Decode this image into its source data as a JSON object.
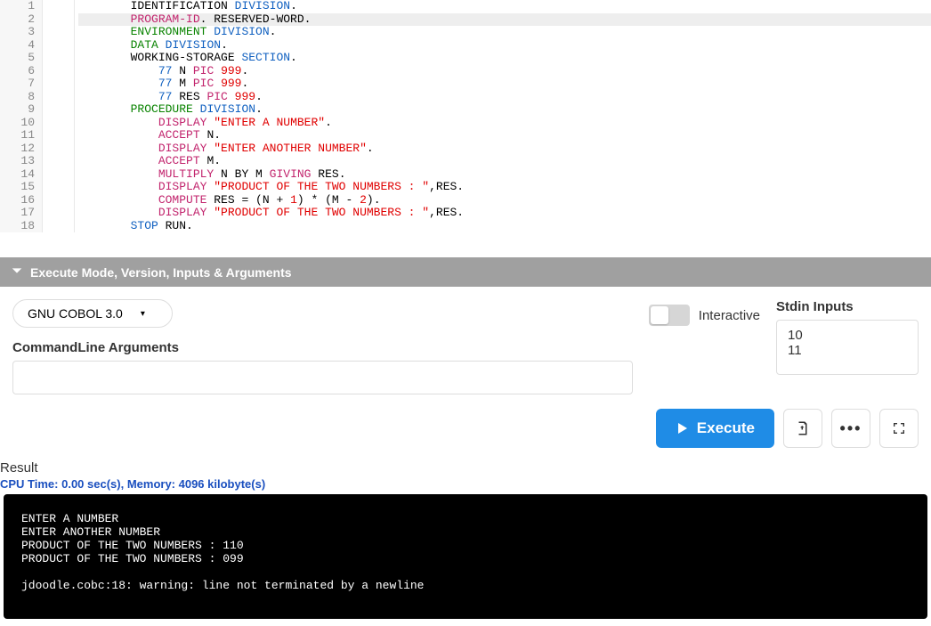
{
  "editor": {
    "lines": [
      {
        "n": 1,
        "hl": false,
        "tokens": [
          {
            "t": "       IDENTIFICATION ",
            "c": "kw-black"
          },
          {
            "t": "DIVISION",
            "c": "kw-blue"
          },
          {
            "t": ".",
            "c": "kw-black"
          }
        ]
      },
      {
        "n": 2,
        "hl": true,
        "tokens": [
          {
            "t": "       ",
            "c": "kw-black"
          },
          {
            "t": "PROGRAM-ID",
            "c": "kw-pink"
          },
          {
            "t": ". RESERVED-WORD.",
            "c": "kw-black"
          }
        ]
      },
      {
        "n": 3,
        "hl": false,
        "tokens": [
          {
            "t": "       ",
            "c": "kw-black"
          },
          {
            "t": "ENVIRONMENT",
            "c": "kw-green"
          },
          {
            "t": " ",
            "c": "kw-black"
          },
          {
            "t": "DIVISION",
            "c": "kw-blue"
          },
          {
            "t": ".",
            "c": "kw-black"
          }
        ]
      },
      {
        "n": 4,
        "hl": false,
        "tokens": [
          {
            "t": "       ",
            "c": "kw-black"
          },
          {
            "t": "DATA",
            "c": "kw-green"
          },
          {
            "t": " ",
            "c": "kw-black"
          },
          {
            "t": "DIVISION",
            "c": "kw-blue"
          },
          {
            "t": ".",
            "c": "kw-black"
          }
        ]
      },
      {
        "n": 5,
        "hl": false,
        "tokens": [
          {
            "t": "       WORKING-STORAGE ",
            "c": "kw-black"
          },
          {
            "t": "SECTION",
            "c": "kw-blue"
          },
          {
            "t": ".",
            "c": "kw-black"
          }
        ]
      },
      {
        "n": 6,
        "hl": false,
        "tokens": [
          {
            "t": "           ",
            "c": "kw-black"
          },
          {
            "t": "77",
            "c": "kw-blue"
          },
          {
            "t": " N ",
            "c": "kw-black"
          },
          {
            "t": "PIC",
            "c": "kw-pink"
          },
          {
            "t": " ",
            "c": "kw-black"
          },
          {
            "t": "999",
            "c": "kw-red"
          },
          {
            "t": ".",
            "c": "kw-black"
          }
        ]
      },
      {
        "n": 7,
        "hl": false,
        "tokens": [
          {
            "t": "           ",
            "c": "kw-black"
          },
          {
            "t": "77",
            "c": "kw-blue"
          },
          {
            "t": " M ",
            "c": "kw-black"
          },
          {
            "t": "PIC",
            "c": "kw-pink"
          },
          {
            "t": " ",
            "c": "kw-black"
          },
          {
            "t": "999",
            "c": "kw-red"
          },
          {
            "t": ".",
            "c": "kw-black"
          }
        ]
      },
      {
        "n": 8,
        "hl": false,
        "tokens": [
          {
            "t": "           ",
            "c": "kw-black"
          },
          {
            "t": "77",
            "c": "kw-blue"
          },
          {
            "t": " RES ",
            "c": "kw-black"
          },
          {
            "t": "PIC",
            "c": "kw-pink"
          },
          {
            "t": " ",
            "c": "kw-black"
          },
          {
            "t": "999",
            "c": "kw-red"
          },
          {
            "t": ".",
            "c": "kw-black"
          }
        ]
      },
      {
        "n": 9,
        "hl": false,
        "tokens": [
          {
            "t": "       ",
            "c": "kw-black"
          },
          {
            "t": "PROCEDURE",
            "c": "kw-green"
          },
          {
            "t": " ",
            "c": "kw-black"
          },
          {
            "t": "DIVISION",
            "c": "kw-blue"
          },
          {
            "t": ".",
            "c": "kw-black"
          }
        ]
      },
      {
        "n": 10,
        "hl": false,
        "tokens": [
          {
            "t": "           ",
            "c": "kw-black"
          },
          {
            "t": "DISPLAY",
            "c": "kw-pink"
          },
          {
            "t": " ",
            "c": "kw-black"
          },
          {
            "t": "\"ENTER A NUMBER\"",
            "c": "kw-red"
          },
          {
            "t": ".",
            "c": "kw-black"
          }
        ]
      },
      {
        "n": 11,
        "hl": false,
        "tokens": [
          {
            "t": "           ",
            "c": "kw-black"
          },
          {
            "t": "ACCEPT",
            "c": "kw-pink"
          },
          {
            "t": " N.",
            "c": "kw-black"
          }
        ]
      },
      {
        "n": 12,
        "hl": false,
        "tokens": [
          {
            "t": "           ",
            "c": "kw-black"
          },
          {
            "t": "DISPLAY",
            "c": "kw-pink"
          },
          {
            "t": " ",
            "c": "kw-black"
          },
          {
            "t": "\"ENTER ANOTHER NUMBER\"",
            "c": "kw-red"
          },
          {
            "t": ".",
            "c": "kw-black"
          }
        ]
      },
      {
        "n": 13,
        "hl": false,
        "tokens": [
          {
            "t": "           ",
            "c": "kw-black"
          },
          {
            "t": "ACCEPT",
            "c": "kw-pink"
          },
          {
            "t": " M.",
            "c": "kw-black"
          }
        ]
      },
      {
        "n": 14,
        "hl": false,
        "tokens": [
          {
            "t": "           ",
            "c": "kw-black"
          },
          {
            "t": "MULTIPLY",
            "c": "kw-pink"
          },
          {
            "t": " N BY M ",
            "c": "kw-black"
          },
          {
            "t": "GIVING",
            "c": "kw-pink"
          },
          {
            "t": " RES.",
            "c": "kw-black"
          }
        ]
      },
      {
        "n": 15,
        "hl": false,
        "tokens": [
          {
            "t": "           ",
            "c": "kw-black"
          },
          {
            "t": "DISPLAY",
            "c": "kw-pink"
          },
          {
            "t": " ",
            "c": "kw-black"
          },
          {
            "t": "\"PRODUCT OF THE TWO NUMBERS : \"",
            "c": "kw-red"
          },
          {
            "t": ",RES.",
            "c": "kw-black"
          }
        ]
      },
      {
        "n": 16,
        "hl": false,
        "tokens": [
          {
            "t": "           ",
            "c": "kw-black"
          },
          {
            "t": "COMPUTE",
            "c": "kw-pink"
          },
          {
            "t": " RES = (N + ",
            "c": "kw-black"
          },
          {
            "t": "1",
            "c": "kw-red"
          },
          {
            "t": ") * (M - ",
            "c": "kw-black"
          },
          {
            "t": "2",
            "c": "kw-red"
          },
          {
            "t": ").",
            "c": "kw-black"
          }
        ]
      },
      {
        "n": 17,
        "hl": false,
        "tokens": [
          {
            "t": "           ",
            "c": "kw-black"
          },
          {
            "t": "DISPLAY",
            "c": "kw-pink"
          },
          {
            "t": " ",
            "c": "kw-black"
          },
          {
            "t": "\"PRODUCT OF THE TWO NUMBERS : \"",
            "c": "kw-red"
          },
          {
            "t": ",RES.",
            "c": "kw-black"
          }
        ]
      },
      {
        "n": 18,
        "hl": false,
        "tokens": [
          {
            "t": "       ",
            "c": "kw-black"
          },
          {
            "t": "STOP",
            "c": "kw-blue"
          },
          {
            "t": " RUN.",
            "c": "kw-black"
          }
        ]
      }
    ]
  },
  "section": {
    "title": "Execute Mode, Version, Inputs & Arguments"
  },
  "controls": {
    "version": "GNU COBOL 3.0",
    "cmdline_label": "CommandLine Arguments",
    "cmdline_value": "",
    "interactive_label": "Interactive",
    "stdin_label": "Stdin Inputs",
    "stdin_value": "10\n11"
  },
  "buttons": {
    "execute": "Execute"
  },
  "result": {
    "label": "Result",
    "stats": "CPU Time: 0.00 sec(s), Memory: 4096 kilobyte(s)",
    "output": "ENTER A NUMBER\nENTER ANOTHER NUMBER\nPRODUCT OF THE TWO NUMBERS : 110\nPRODUCT OF THE TWO NUMBERS : 099\n\njdoodle.cobc:18: warning: line not terminated by a newline"
  }
}
